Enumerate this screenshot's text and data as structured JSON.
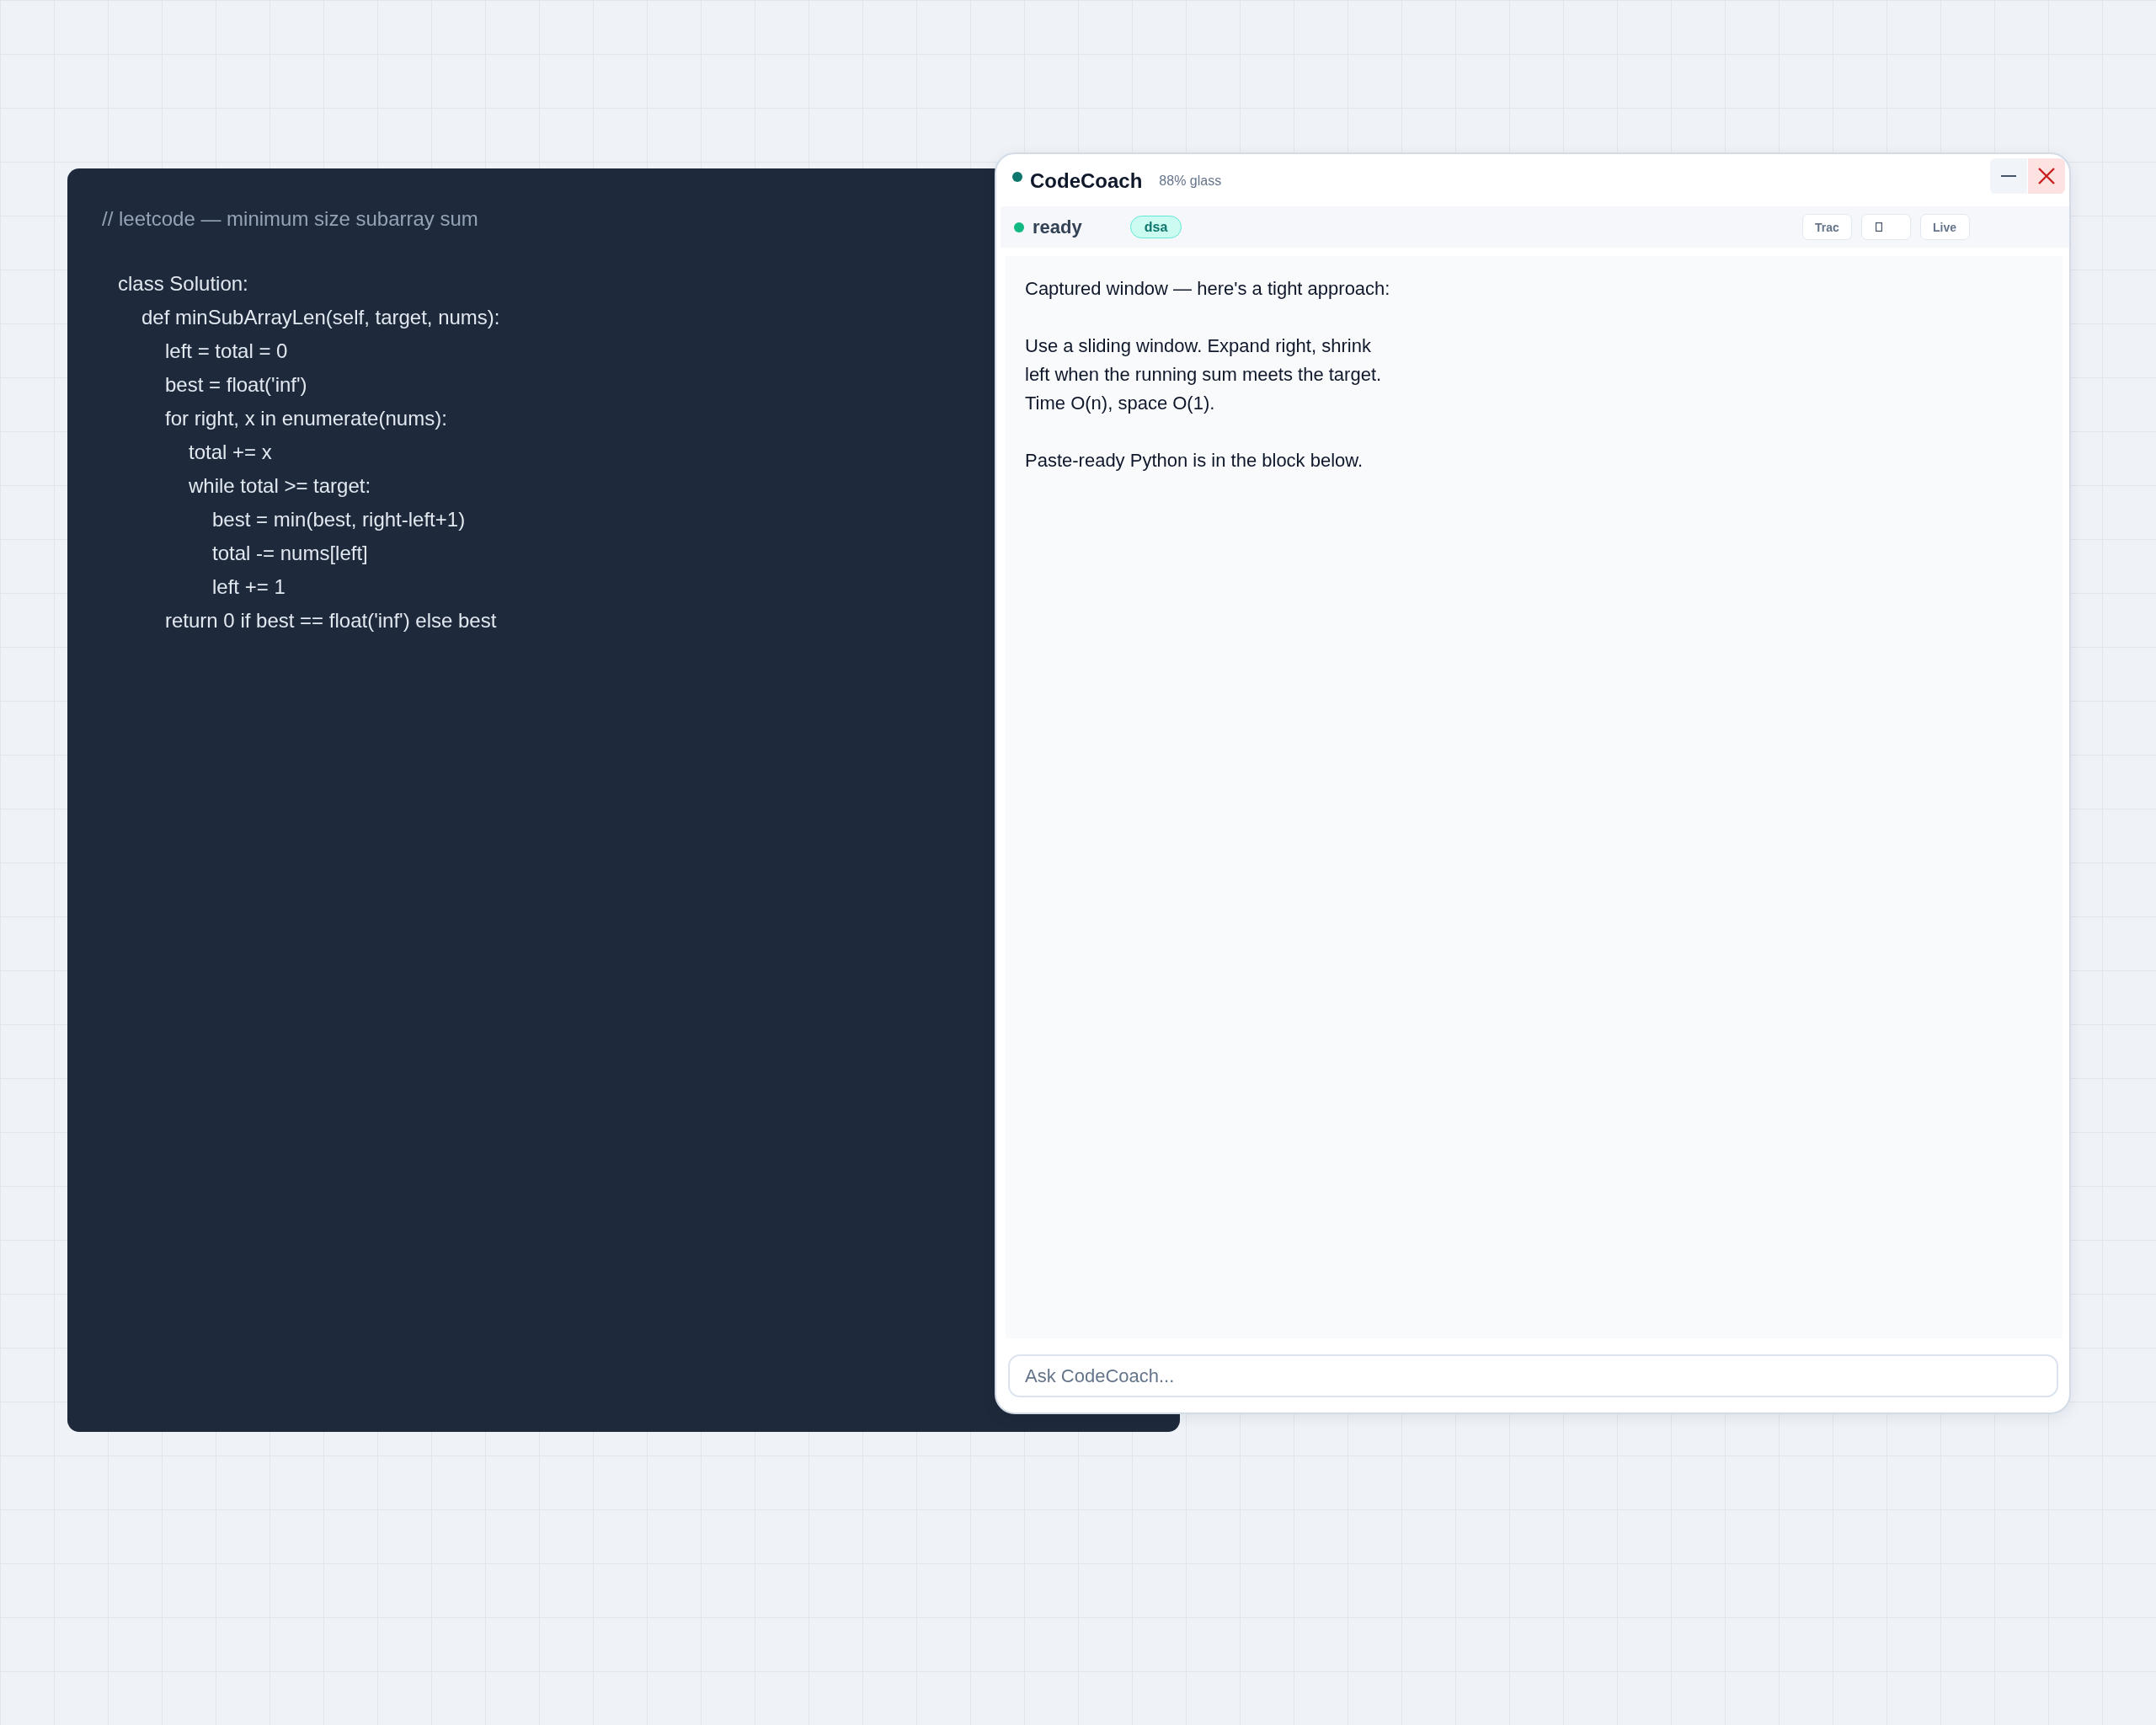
{
  "code_window": {
    "comment": "// leetcode — minimum size subarray sum",
    "lines": [
      {
        "text": "class Solution:",
        "children": [
          {
            "text": "def minSubArrayLen(self, target, nums):",
            "children": [
              {
                "text": "left = total = 0"
              },
              {
                "text": "best = float('inf')"
              },
              {
                "text": "for right, x in enumerate(nums):",
                "children": [
                  {
                    "text": "total += x"
                  },
                  {
                    "text": "while total >= target:",
                    "children": [
                      {
                        "text": "best = min(best, right-left+1)"
                      },
                      {
                        "text": "total -= nums[left]"
                      },
                      {
                        "text": "left += 1"
                      }
                    ]
                  }
                ]
              },
              {
                "text": "return 0 if best == float('inf') else best"
              }
            ]
          }
        ]
      }
    ]
  },
  "assistant": {
    "title": "CodeCoach",
    "subtitle": "88% glass",
    "window_controls": [
      {
        "kind": "minimize"
      },
      {
        "kind": "close"
      }
    ],
    "status": {
      "label": "ready",
      "tag": "dsa"
    },
    "toolbar": [
      {
        "kind": "text",
        "label": "Trac"
      },
      {
        "kind": "icon"
      },
      {
        "kind": "text",
        "label": "Live"
      }
    ],
    "message": [
      "Captured window — here's a tight approach:",
      "Use a sliding window. Expand right, shrink\nleft when the running sum meets the target.\nTime O(n), space O(1).",
      "Paste-ready Python is in the block below."
    ],
    "input": {
      "placeholder": "Ask CodeCoach..."
    }
  }
}
